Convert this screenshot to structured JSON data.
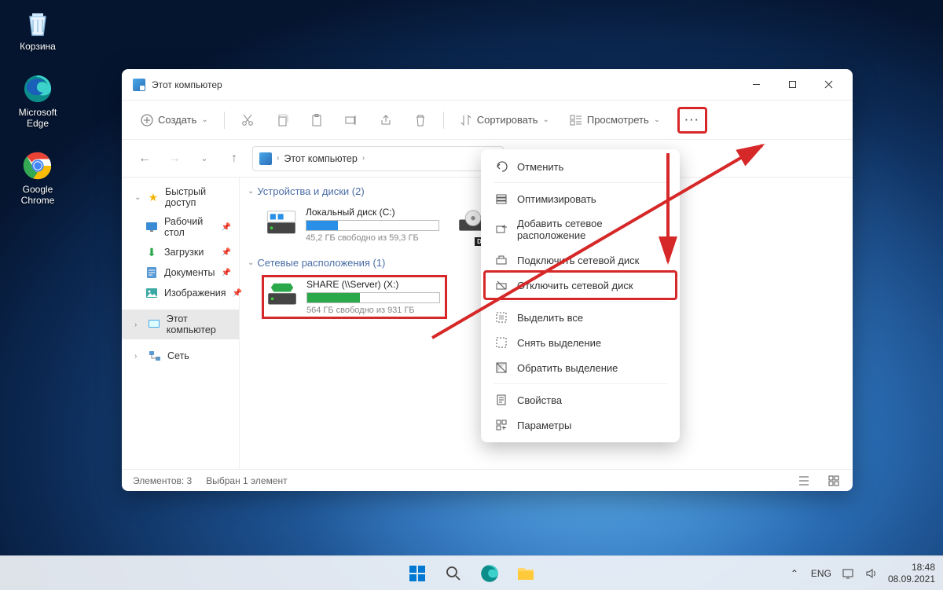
{
  "desktop": {
    "recycle_bin": "Корзина",
    "edge": "Microsoft Edge",
    "chrome": "Google Chrome"
  },
  "window": {
    "title": "Этот компьютер",
    "toolbar": {
      "create": "Создать",
      "sort": "Сортировать",
      "view": "Просмотреть"
    },
    "breadcrumb": {
      "root": "Этот компьютер"
    },
    "sidebar": {
      "quick_access": "Быстрый доступ",
      "desktop": "Рабочий стол",
      "downloads": "Загрузки",
      "documents": "Документы",
      "pictures": "Изображения",
      "this_pc": "Этот компьютер",
      "network": "Сеть"
    },
    "groups": {
      "devices": "Устройства и диски (2)",
      "network_loc": "Сетевые расположения (1)"
    },
    "drives": {
      "local_c": {
        "name": "Локальный диск (C:)",
        "free": "45,2 ГБ свободно из 59,3 ГБ",
        "fill_pct": 24,
        "fill_color": "#2a8fe6"
      },
      "dvd": {
        "name": "",
        "free": ""
      },
      "share_x": {
        "name": "SHARE (\\\\Server) (X:)",
        "free": "564 ГБ свободно из 931 ГБ",
        "fill_pct": 40,
        "fill_color": "#2aa84a"
      }
    },
    "statusbar": {
      "elements": "Элементов: 3",
      "selected": "Выбран 1 элемент"
    }
  },
  "ctx": {
    "undo": "Отменить",
    "optimize": "Оптимизировать",
    "add_net_loc": "Добавить сетевое расположение",
    "map_drive": "Подключить сетевой диск",
    "disconnect_drive": "Отключить сетевой диск",
    "select_all": "Выделить все",
    "select_none": "Снять выделение",
    "invert_sel": "Обратить выделение",
    "properties": "Свойства",
    "options": "Параметры"
  },
  "taskbar": {
    "lang": "ENG",
    "time": "18:48",
    "date": "08.09.2021"
  }
}
